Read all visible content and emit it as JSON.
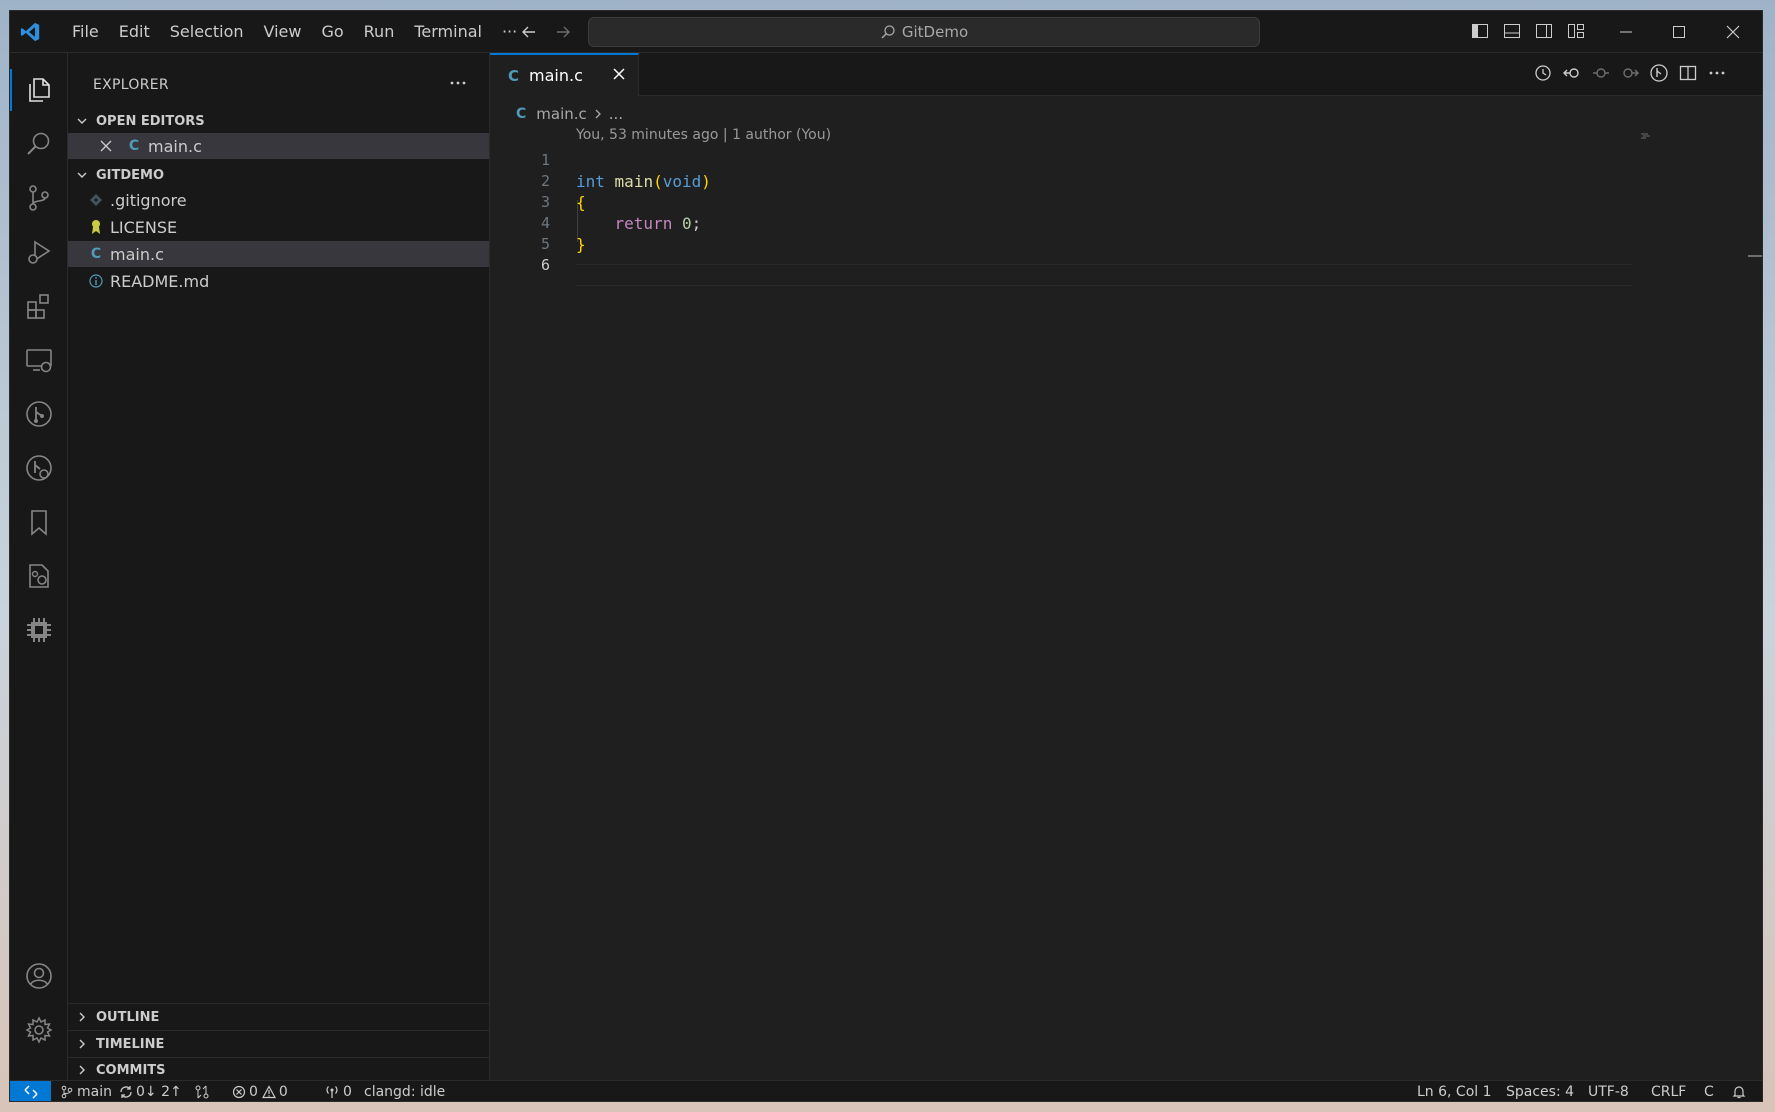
{
  "titlebar": {
    "menu": [
      "File",
      "Edit",
      "Selection",
      "View",
      "Go",
      "Run",
      "Terminal",
      "···"
    ],
    "search_text": "GitDemo"
  },
  "sidebar": {
    "title": "EXPLORER",
    "open_editors": {
      "label": "OPEN EDITORS",
      "items": [
        {
          "icon": "C",
          "name": "main.c"
        }
      ]
    },
    "folder": {
      "label": "GITDEMO",
      "items": [
        {
          "icon": "gitignore-icon",
          "name": ".gitignore"
        },
        {
          "icon": "license-icon",
          "name": "LICENSE"
        },
        {
          "icon": "C",
          "name": "main.c"
        },
        {
          "icon": "info-icon",
          "name": "README.md"
        }
      ]
    },
    "bottom_sections": [
      "OUTLINE",
      "TIMELINE",
      "COMMITS"
    ]
  },
  "editor": {
    "tab": {
      "icon": "C",
      "label": "main.c"
    },
    "breadcrumb": {
      "file": "main.c",
      "rest": "..."
    },
    "codelens": "You, 53 minutes ago | 1 author (You)",
    "line_numbers": [
      "1",
      "2",
      "3",
      "4",
      "5",
      "6"
    ],
    "current_line": "6",
    "code": {
      "l2_type": "int",
      "l2_fn": "main",
      "l2_open": "(",
      "l2_param": "void",
      "l2_close": ")",
      "l3": "{",
      "l4_kw": "return",
      "l4_num": "0",
      "l4_semi": ";",
      "l5": "}"
    }
  },
  "statusbar": {
    "branch": "main",
    "sync": "0↓ 2↑",
    "errors": "0",
    "warnings": "0",
    "ports": "0",
    "clangd": "clangd: idle",
    "position": "Ln 6, Col 1",
    "spaces": "Spaces: 4",
    "encoding": "UTF-8",
    "eol": "CRLF",
    "language": "C"
  },
  "colors": {
    "accent": "#0078d4",
    "background": "#1f1f1f",
    "sidebar": "#181818",
    "selection": "#37373d"
  }
}
